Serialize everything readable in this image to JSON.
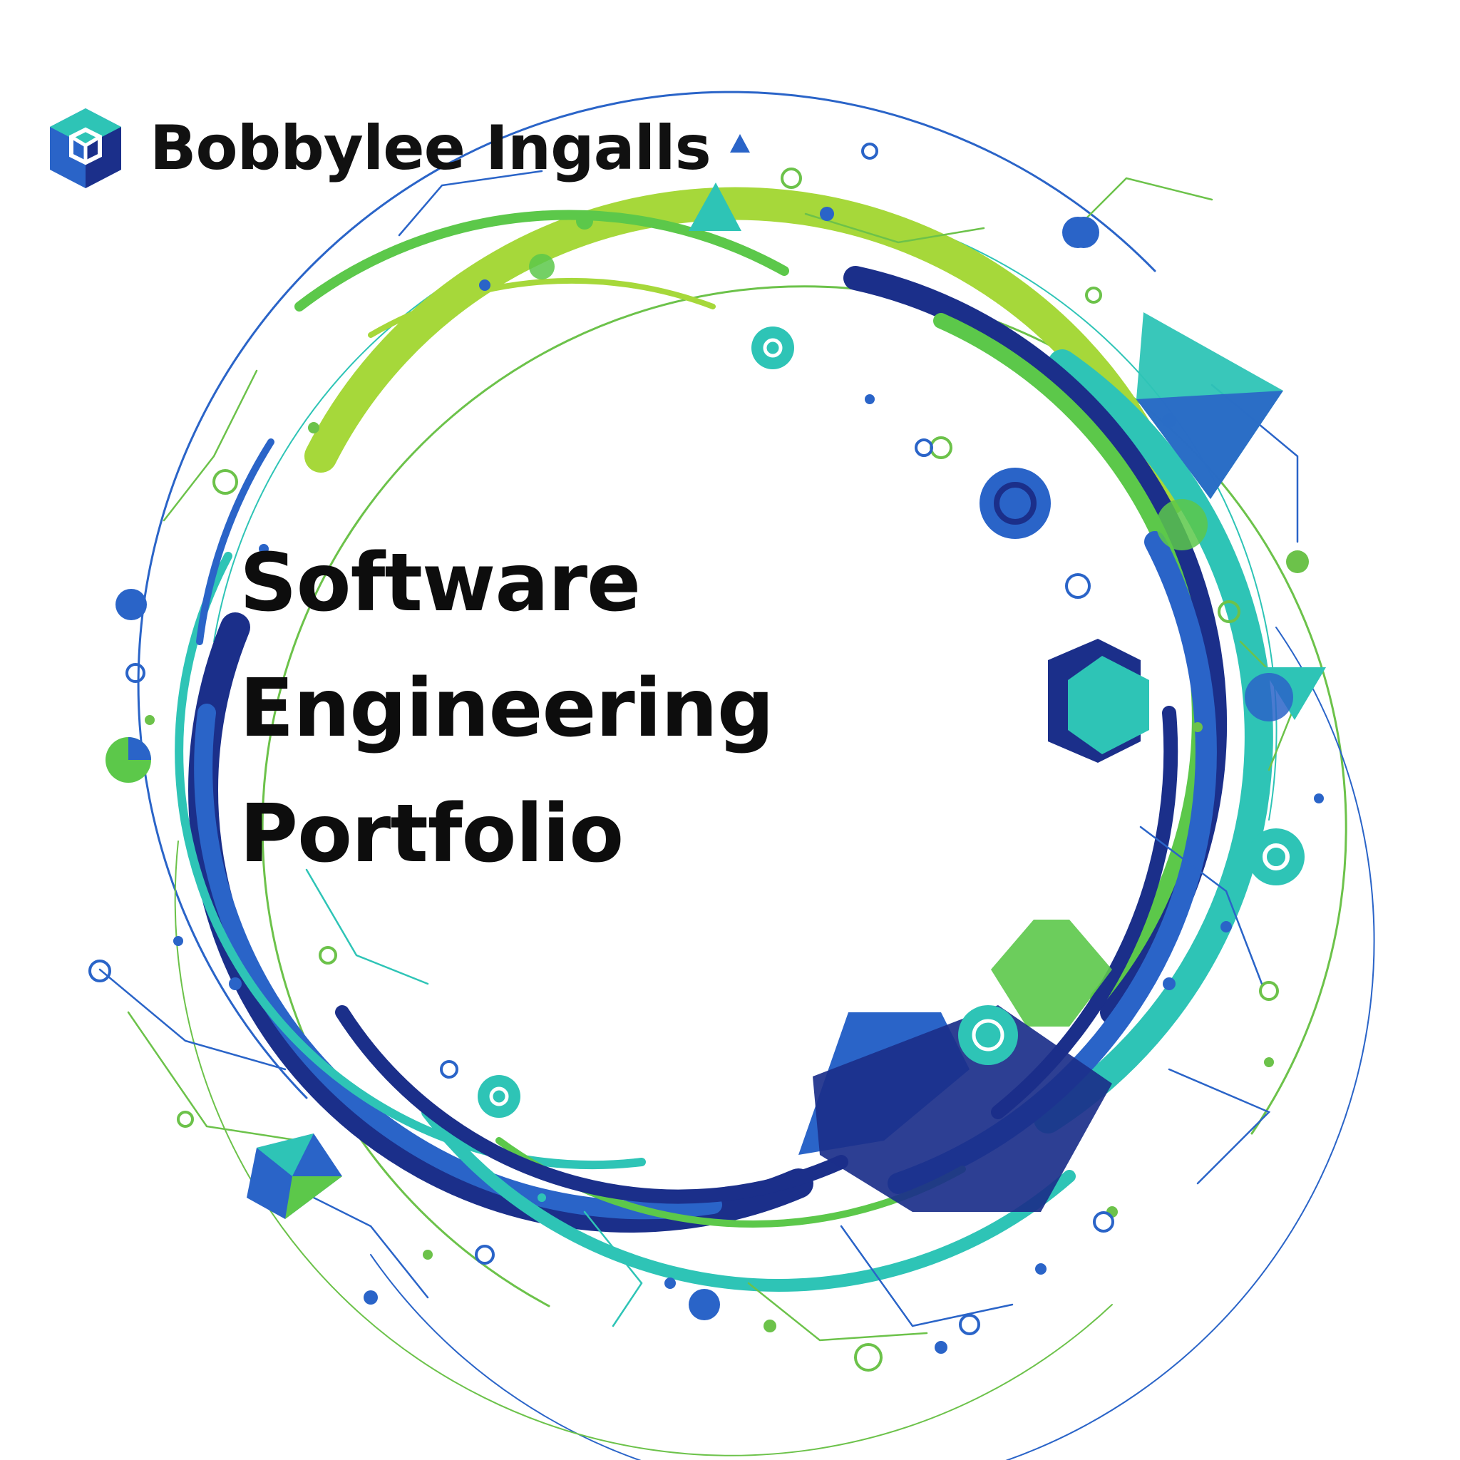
{
  "header": {
    "name": "Bobbylee Ingalls",
    "logo_icon": "cube-icon"
  },
  "title": {
    "line1": "Software",
    "line2": "Engineering",
    "line3": "Portfolio"
  },
  "palette": {
    "navy": "#1b2f8a",
    "blue": "#2a64c8",
    "teal": "#2ec4b6",
    "green": "#5cc84a",
    "lime": "#a6d83a"
  },
  "decor": {
    "ring_icon": "circuit-ring-icon"
  }
}
